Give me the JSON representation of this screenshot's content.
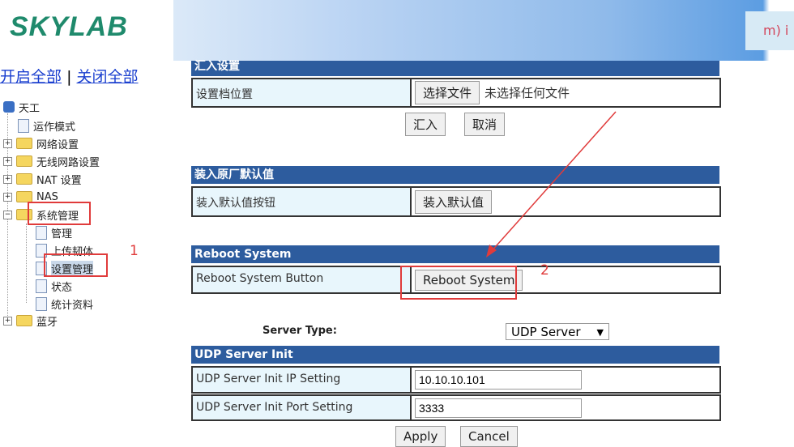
{
  "brand": {
    "logo": "SKYLAB",
    "badge": "m) i"
  },
  "sidebar": {
    "expand_all": "开启全部",
    "separator": "|",
    "collapse_all": "关闭全部",
    "root": "天工",
    "items": [
      {
        "label": "运作模式",
        "type": "doc"
      },
      {
        "label": "网络设置",
        "type": "folder"
      },
      {
        "label": "无线网路设置",
        "type": "folder"
      },
      {
        "label": "NAT 设置",
        "type": "folder"
      },
      {
        "label": "NAS",
        "type": "folder"
      },
      {
        "label": "系统管理",
        "type": "folder",
        "expanded": true
      },
      {
        "label": "蓝牙",
        "type": "folder"
      }
    ],
    "sub_items": [
      {
        "label": "管理"
      },
      {
        "label": "上传韧体"
      },
      {
        "label": "设置管理",
        "selected": true
      },
      {
        "label": "状态"
      },
      {
        "label": "统计资料"
      }
    ]
  },
  "import": {
    "title": "汇入设置",
    "label": "设置档位置",
    "choose": "选择文件",
    "no_file": "未选择任何文件",
    "import_btn": "汇入",
    "cancel_btn": "取消"
  },
  "defaults": {
    "title": "装入原厂默认值",
    "label": "装入默认值按钮",
    "button": "装入默认值"
  },
  "reboot": {
    "title": "Reboot System",
    "label": "Reboot System Button",
    "button": "Reboot System"
  },
  "server": {
    "type_label": "Server Type:",
    "type_value": "UDP Server",
    "title": "UDP Server Init",
    "ip_label": "UDP Server Init IP Setting",
    "ip_value": "10.10.10.101",
    "port_label": "UDP Server Init Port Setting",
    "port_value": "3333",
    "apply": "Apply",
    "cancel": "Cancel"
  },
  "annotations": {
    "step1": "1",
    "step2": "2",
    "color": "#e03b3b"
  }
}
